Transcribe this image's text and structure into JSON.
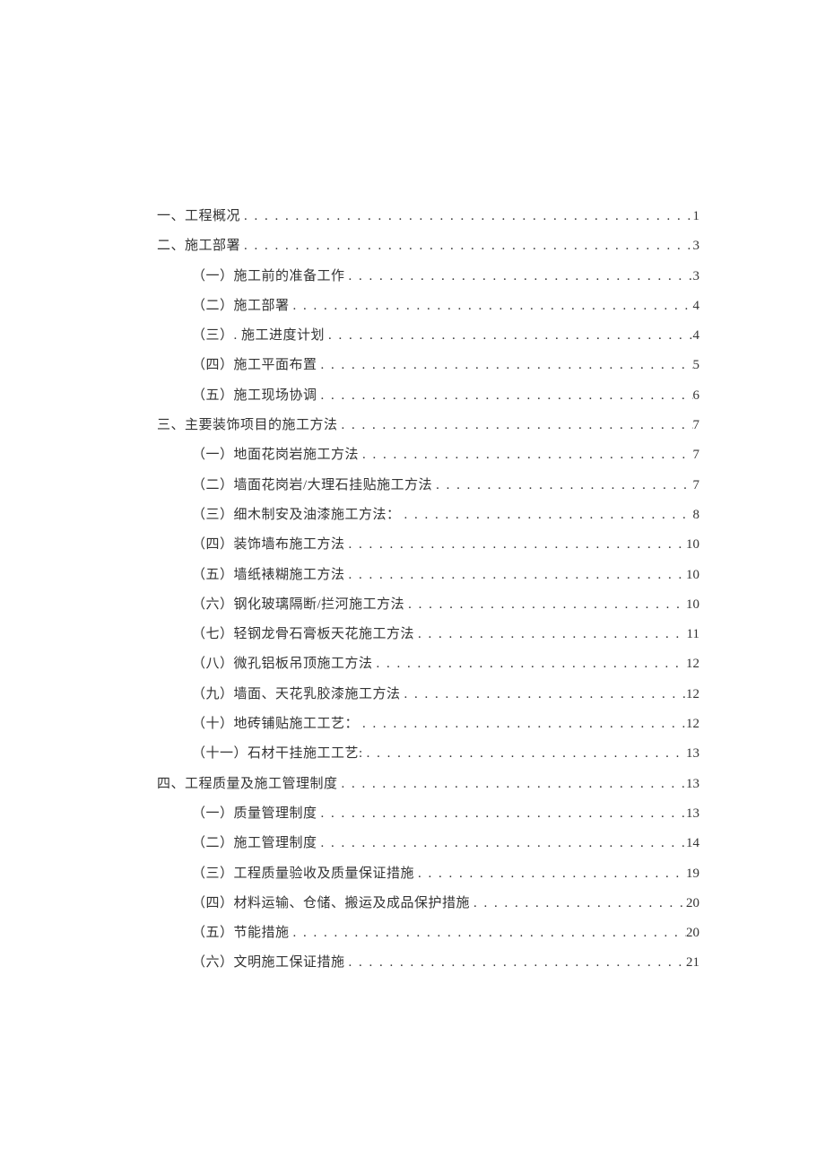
{
  "toc": [
    {
      "level": 1,
      "title": "一、工程概况",
      "page": "1"
    },
    {
      "level": 1,
      "title": "二、施工部署",
      "page": "3"
    },
    {
      "level": 2,
      "title": "（一）施工前的准备工作",
      "page": "3"
    },
    {
      "level": 2,
      "title": "（二）施工部署",
      "page": "4"
    },
    {
      "level": 2,
      "title": "（三）. 施工进度计划",
      "page": "4"
    },
    {
      "level": 2,
      "title": "（四）施工平面布置",
      "page": "5"
    },
    {
      "level": 2,
      "title": "（五）施工现场协调",
      "page": "6"
    },
    {
      "level": 1,
      "title": "三、主要装饰项目的施工方法",
      "page": "7"
    },
    {
      "level": 2,
      "title": "（一）地面花岗岩施工方法",
      "page": "7"
    },
    {
      "level": 2,
      "title": "（二）墙面花岗岩/大理石挂贴施工方法",
      "page": "7"
    },
    {
      "level": 2,
      "title": "（三）细木制安及油漆施工方法：",
      "page": "8"
    },
    {
      "level": 2,
      "title": "（四）装饰墙布施工方法",
      "page": "10"
    },
    {
      "level": 2,
      "title": "（五）墙纸裱糊施工方法",
      "page": "10"
    },
    {
      "level": 2,
      "title": "（六）钢化玻璃隔断/拦河施工方法",
      "page": "10"
    },
    {
      "level": 2,
      "title": "（七）轻钢龙骨石膏板天花施工方法",
      "page": "11"
    },
    {
      "level": 2,
      "title": "（八）微孔铝板吊顶施工方法",
      "page": "12"
    },
    {
      "level": 2,
      "title": "（九）墙面、天花乳胶漆施工方法",
      "page": "12"
    },
    {
      "level": 2,
      "title": "（十）地砖铺贴施工工艺：",
      "page": "12"
    },
    {
      "level": 2,
      "title": "（十一）石材干挂施工工艺:",
      "page": "13"
    },
    {
      "level": 1,
      "title": "四、工程质量及施工管理制度",
      "page": "13"
    },
    {
      "level": 2,
      "title": "（一）质量管理制度",
      "page": "13"
    },
    {
      "level": 2,
      "title": "（二）施工管理制度",
      "page": "14"
    },
    {
      "level": 2,
      "title": "（三）工程质量验收及质量保证措施",
      "page": "19"
    },
    {
      "level": 2,
      "title": "（四）材料运输、仓储、搬运及成品保护措施",
      "page": "20"
    },
    {
      "level": 2,
      "title": "（五）节能措施",
      "page": "20"
    },
    {
      "level": 2,
      "title": "（六）文明施工保证措施",
      "page": "21"
    }
  ]
}
